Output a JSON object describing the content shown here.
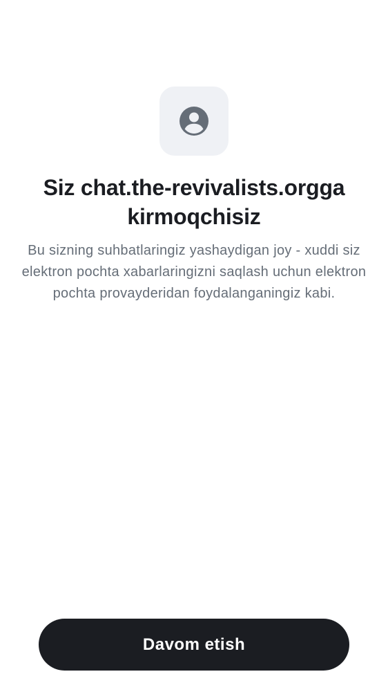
{
  "header": {
    "icon": "user-circle-icon",
    "title": "Siz chat.the-revivalists.orgga kirmoqchisiz",
    "description": "Bu sizning suhbatlaringiz yashaydigan joy - xuddi siz elektron pochta xabarlaringizni saqlash uchun elektron pochta provayderidan foydalanganingiz kabi."
  },
  "actions": {
    "continue_label": "Davom etish"
  },
  "colors": {
    "background": "#ffffff",
    "tile_background": "#eff1f5",
    "icon": "#656d77",
    "title_text": "#1b1d22",
    "body_text": "#656d77",
    "button_background": "#1b1d22",
    "button_text": "#ffffff"
  }
}
